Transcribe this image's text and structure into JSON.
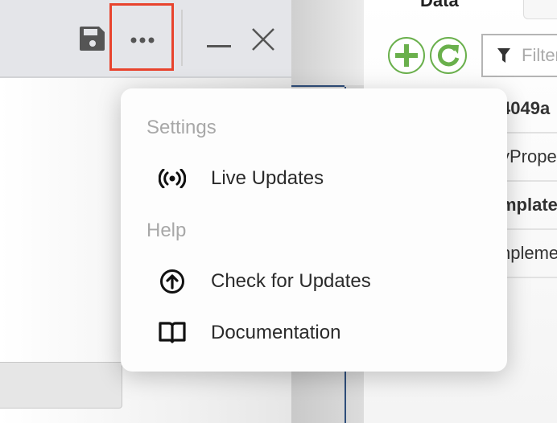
{
  "toolbar": {
    "save_icon": "floppy-disk-icon",
    "more_icon": "ellipsis-icon",
    "minimize_icon": "minimize-icon",
    "close_icon": "close-icon",
    "highlight_color": "#e8432d"
  },
  "data_panel": {
    "tab_label": "Data",
    "add_icon": "plus-circle-icon",
    "refresh_icon": "refresh-circle-icon",
    "accent": "#6ab04c",
    "filter_placeholder": "Filter",
    "rows": [
      {
        "text": "4049a",
        "bold": true
      },
      {
        "text": "yPrope",
        "bold": false
      },
      {
        "text": "mplate",
        "bold": true
      },
      {
        "text": "npleme",
        "bold": false
      }
    ]
  },
  "menu": {
    "sections": [
      {
        "header": "Settings",
        "items": [
          {
            "label": "Live Updates",
            "icon": "broadcast-icon"
          }
        ]
      },
      {
        "header": "Help",
        "items": [
          {
            "label": "Check for Updates",
            "icon": "arrow-up-circle-icon"
          },
          {
            "label": "Documentation",
            "icon": "book-icon"
          }
        ]
      }
    ]
  }
}
